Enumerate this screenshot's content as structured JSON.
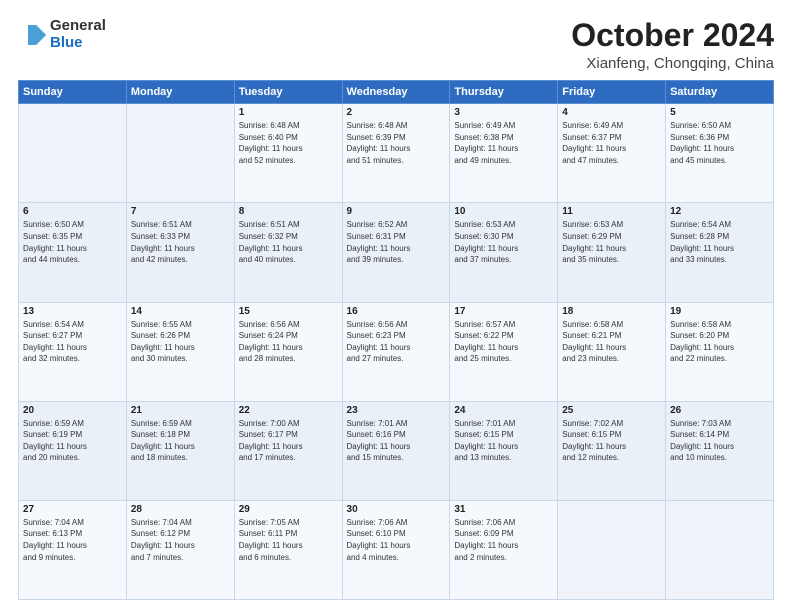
{
  "logo": {
    "general": "General",
    "blue": "Blue"
  },
  "title": "October 2024",
  "location": "Xianfeng, Chongqing, China",
  "headers": [
    "Sunday",
    "Monday",
    "Tuesday",
    "Wednesday",
    "Thursday",
    "Friday",
    "Saturday"
  ],
  "weeks": [
    [
      {
        "day": "",
        "info": ""
      },
      {
        "day": "",
        "info": ""
      },
      {
        "day": "1",
        "info": "Sunrise: 6:48 AM\nSunset: 6:40 PM\nDaylight: 11 hours\nand 52 minutes."
      },
      {
        "day": "2",
        "info": "Sunrise: 6:48 AM\nSunset: 6:39 PM\nDaylight: 11 hours\nand 51 minutes."
      },
      {
        "day": "3",
        "info": "Sunrise: 6:49 AM\nSunset: 6:38 PM\nDaylight: 11 hours\nand 49 minutes."
      },
      {
        "day": "4",
        "info": "Sunrise: 6:49 AM\nSunset: 6:37 PM\nDaylight: 11 hours\nand 47 minutes."
      },
      {
        "day": "5",
        "info": "Sunrise: 6:50 AM\nSunset: 6:36 PM\nDaylight: 11 hours\nand 45 minutes."
      }
    ],
    [
      {
        "day": "6",
        "info": "Sunrise: 6:50 AM\nSunset: 6:35 PM\nDaylight: 11 hours\nand 44 minutes."
      },
      {
        "day": "7",
        "info": "Sunrise: 6:51 AM\nSunset: 6:33 PM\nDaylight: 11 hours\nand 42 minutes."
      },
      {
        "day": "8",
        "info": "Sunrise: 6:51 AM\nSunset: 6:32 PM\nDaylight: 11 hours\nand 40 minutes."
      },
      {
        "day": "9",
        "info": "Sunrise: 6:52 AM\nSunset: 6:31 PM\nDaylight: 11 hours\nand 39 minutes."
      },
      {
        "day": "10",
        "info": "Sunrise: 6:53 AM\nSunset: 6:30 PM\nDaylight: 11 hours\nand 37 minutes."
      },
      {
        "day": "11",
        "info": "Sunrise: 6:53 AM\nSunset: 6:29 PM\nDaylight: 11 hours\nand 35 minutes."
      },
      {
        "day": "12",
        "info": "Sunrise: 6:54 AM\nSunset: 6:28 PM\nDaylight: 11 hours\nand 33 minutes."
      }
    ],
    [
      {
        "day": "13",
        "info": "Sunrise: 6:54 AM\nSunset: 6:27 PM\nDaylight: 11 hours\nand 32 minutes."
      },
      {
        "day": "14",
        "info": "Sunrise: 6:55 AM\nSunset: 6:26 PM\nDaylight: 11 hours\nand 30 minutes."
      },
      {
        "day": "15",
        "info": "Sunrise: 6:56 AM\nSunset: 6:24 PM\nDaylight: 11 hours\nand 28 minutes."
      },
      {
        "day": "16",
        "info": "Sunrise: 6:56 AM\nSunset: 6:23 PM\nDaylight: 11 hours\nand 27 minutes."
      },
      {
        "day": "17",
        "info": "Sunrise: 6:57 AM\nSunset: 6:22 PM\nDaylight: 11 hours\nand 25 minutes."
      },
      {
        "day": "18",
        "info": "Sunrise: 6:58 AM\nSunset: 6:21 PM\nDaylight: 11 hours\nand 23 minutes."
      },
      {
        "day": "19",
        "info": "Sunrise: 6:58 AM\nSunset: 6:20 PM\nDaylight: 11 hours\nand 22 minutes."
      }
    ],
    [
      {
        "day": "20",
        "info": "Sunrise: 6:59 AM\nSunset: 6:19 PM\nDaylight: 11 hours\nand 20 minutes."
      },
      {
        "day": "21",
        "info": "Sunrise: 6:59 AM\nSunset: 6:18 PM\nDaylight: 11 hours\nand 18 minutes."
      },
      {
        "day": "22",
        "info": "Sunrise: 7:00 AM\nSunset: 6:17 PM\nDaylight: 11 hours\nand 17 minutes."
      },
      {
        "day": "23",
        "info": "Sunrise: 7:01 AM\nSunset: 6:16 PM\nDaylight: 11 hours\nand 15 minutes."
      },
      {
        "day": "24",
        "info": "Sunrise: 7:01 AM\nSunset: 6:15 PM\nDaylight: 11 hours\nand 13 minutes."
      },
      {
        "day": "25",
        "info": "Sunrise: 7:02 AM\nSunset: 6:15 PM\nDaylight: 11 hours\nand 12 minutes."
      },
      {
        "day": "26",
        "info": "Sunrise: 7:03 AM\nSunset: 6:14 PM\nDaylight: 11 hours\nand 10 minutes."
      }
    ],
    [
      {
        "day": "27",
        "info": "Sunrise: 7:04 AM\nSunset: 6:13 PM\nDaylight: 11 hours\nand 9 minutes."
      },
      {
        "day": "28",
        "info": "Sunrise: 7:04 AM\nSunset: 6:12 PM\nDaylight: 11 hours\nand 7 minutes."
      },
      {
        "day": "29",
        "info": "Sunrise: 7:05 AM\nSunset: 6:11 PM\nDaylight: 11 hours\nand 6 minutes."
      },
      {
        "day": "30",
        "info": "Sunrise: 7:06 AM\nSunset: 6:10 PM\nDaylight: 11 hours\nand 4 minutes."
      },
      {
        "day": "31",
        "info": "Sunrise: 7:06 AM\nSunset: 6:09 PM\nDaylight: 11 hours\nand 2 minutes."
      },
      {
        "day": "",
        "info": ""
      },
      {
        "day": "",
        "info": ""
      }
    ]
  ]
}
